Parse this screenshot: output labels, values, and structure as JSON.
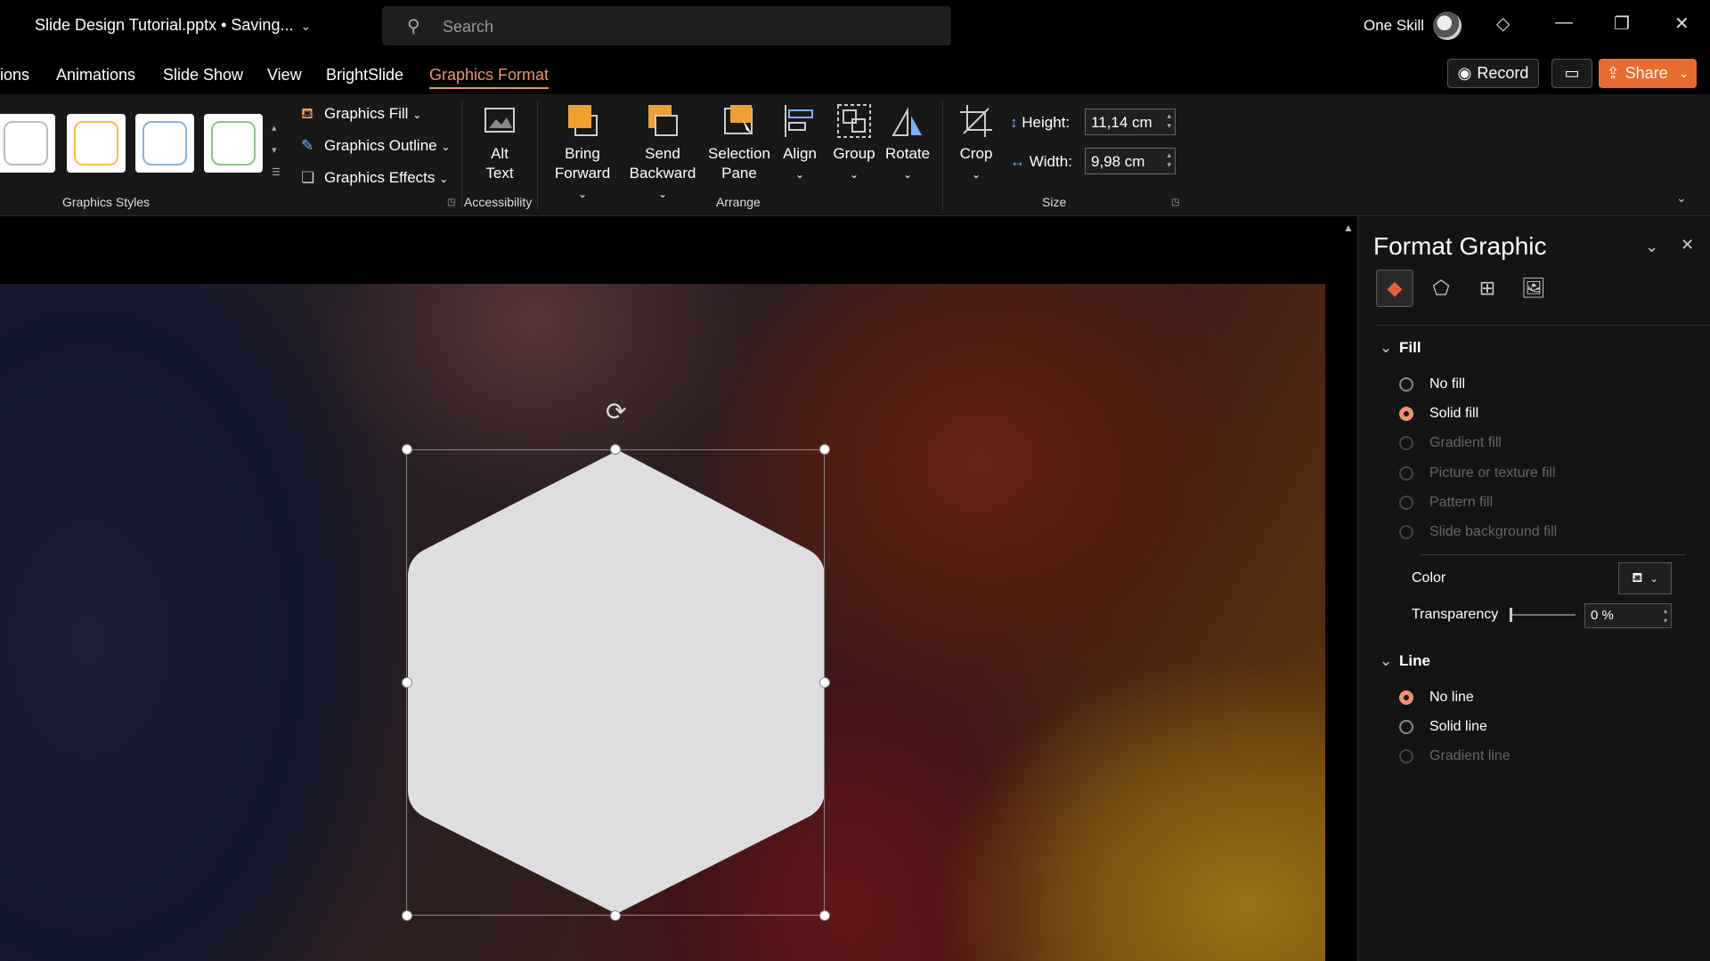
{
  "titlebar": {
    "doc_title": "Slide Design Tutorial.pptx • Saving...",
    "search_placeholder": "Search",
    "user_name": "One Skill"
  },
  "tabs": [
    {
      "label": "ions"
    },
    {
      "label": "Animations"
    },
    {
      "label": "Slide Show"
    },
    {
      "label": "View"
    },
    {
      "label": "BrightSlide"
    },
    {
      "label": "Graphics Format",
      "active": true
    }
  ],
  "header_buttons": {
    "record": "Record",
    "share": "Share"
  },
  "ribbon": {
    "graphics_fill": "Graphics Fill",
    "graphics_outline": "Graphics Outline",
    "graphics_effects": "Graphics Effects",
    "graphics_styles_label": "Graphics Styles",
    "alt_text_line1": "Alt",
    "alt_text_line2": "Text",
    "accessibility_label": "Accessibility",
    "bring_forward_line1": "Bring",
    "bring_forward_line2": "Forward",
    "send_backward_line1": "Send",
    "send_backward_line2": "Backward",
    "selection_pane_line1": "Selection",
    "selection_pane_line2": "Pane",
    "align": "Align",
    "group": "Group",
    "rotate": "Rotate",
    "arrange_label": "Arrange",
    "crop": "Crop",
    "height_label": "Height:",
    "height_value": "11,14 cm",
    "width_label": "Width:",
    "width_value": "9,98 cm",
    "size_label": "Size"
  },
  "panel": {
    "title": "Format Graphic",
    "fill_section": "Fill",
    "fill_options": [
      {
        "label": "No fill",
        "selected": false,
        "enabled": true
      },
      {
        "label": "Solid fill",
        "selected": true,
        "enabled": true
      },
      {
        "label": "Gradient fill",
        "selected": false,
        "enabled": false
      },
      {
        "label": "Picture or texture fill",
        "selected": false,
        "enabled": false
      },
      {
        "label": "Pattern fill",
        "selected": false,
        "enabled": false
      },
      {
        "label": "Slide background fill",
        "selected": false,
        "enabled": false
      }
    ],
    "color_label": "Color",
    "transparency_label": "Transparency",
    "transparency_value": "0 %",
    "line_section": "Line",
    "line_options": [
      {
        "label": "No line",
        "selected": true,
        "enabled": true
      },
      {
        "label": "Solid line",
        "selected": false,
        "enabled": true
      },
      {
        "label": "Gradient line",
        "selected": false,
        "enabled": false
      }
    ]
  },
  "colors": {
    "accent": "#f0926b",
    "share": "#e86c2e",
    "shape_fill": "#dedddf"
  }
}
